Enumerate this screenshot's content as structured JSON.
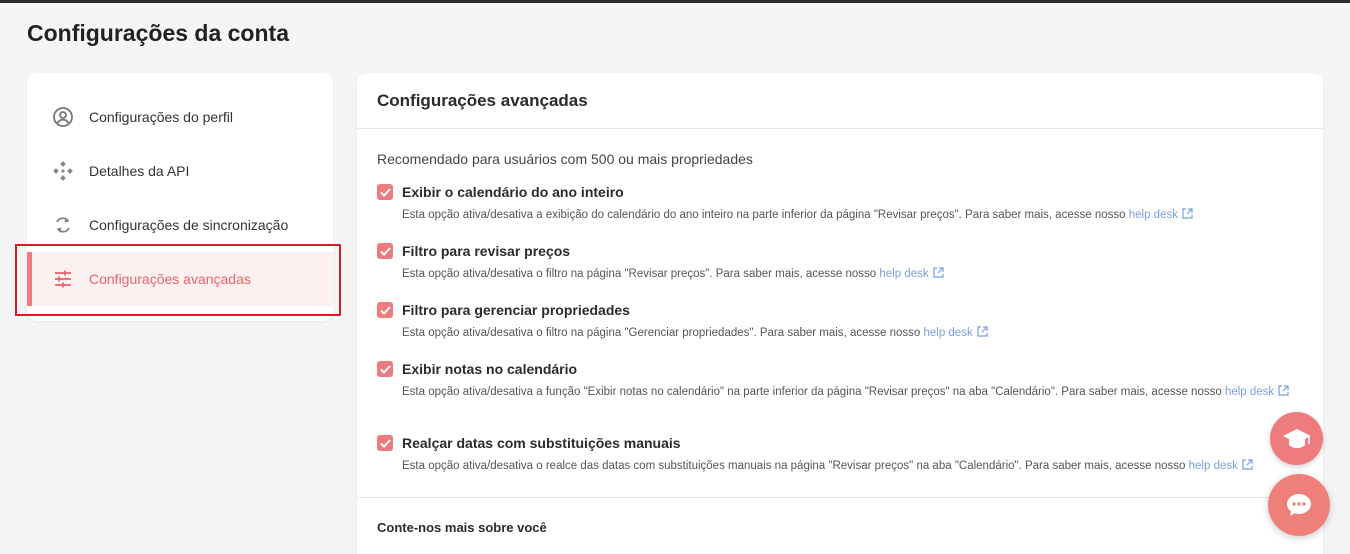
{
  "page": {
    "title": "Configurações da conta"
  },
  "sidebar": {
    "items": [
      {
        "label": "Configurações do perfil",
        "icon": "user-circle-icon",
        "active": false
      },
      {
        "label": "Detalhes da API",
        "icon": "api-nodes-icon",
        "active": false
      },
      {
        "label": "Configurações de sincronização",
        "icon": "sync-icon",
        "active": false
      },
      {
        "label": "Configurações avançadas",
        "icon": "sliders-icon",
        "active": true
      }
    ]
  },
  "main": {
    "header": "Configurações avançadas",
    "recommend": "Recomendado para usuários com 500 ou mais propriedades",
    "options": [
      {
        "title": "Exibir o calendário do ano inteiro",
        "desc": "Esta opção ativa/desativa a exibição do calendário do ano inteiro na parte inferior da página \"Revisar preços\". Para saber mais, acesse nosso",
        "link": "help desk",
        "checked": true
      },
      {
        "title": "Filtro para revisar preços",
        "desc": "Esta opção ativa/desativa o filtro na página \"Revisar preços\". Para saber mais, acesse nosso",
        "link": "help desk",
        "checked": true
      },
      {
        "title": "Filtro para gerenciar propriedades",
        "desc": "Esta opção ativa/desativa o filtro na página \"Gerenciar propriedades\". Para saber mais, acesse nosso",
        "link": "help desk",
        "checked": true
      },
      {
        "title": "Exibir notas no calendário",
        "desc": "Esta opção ativa/desativa a função \"Exibir notas no calendário\" na parte inferior da página \"Revisar preços\" na aba \"Calendário\". Para saber mais, acesse nosso",
        "link": "help desk",
        "checked": true
      },
      {
        "title": "Realçar datas com substituições manuais",
        "desc": "Esta opção ativa/desativa o realce das datas com substituições manuais na página \"Revisar preços\" na aba \"Calendário\". Para saber mais, acesse nosso",
        "link": "help desk",
        "checked": true
      }
    ],
    "about": "Conte-nos mais sobre você"
  },
  "colors": {
    "accent": "#ee7b7e",
    "link": "#7aa0de",
    "highlight": "#e11b1b"
  }
}
